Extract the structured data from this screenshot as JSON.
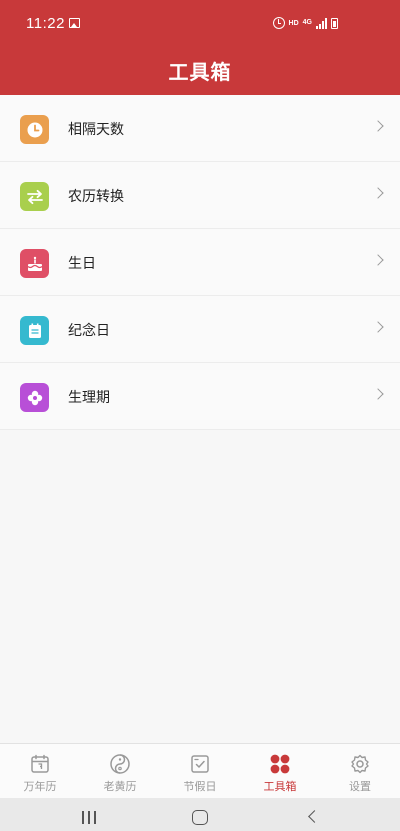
{
  "status": {
    "time": "11:22",
    "hd": "HD",
    "network": "4G"
  },
  "header": {
    "title": "工具箱"
  },
  "tools": [
    {
      "label": "相隔天数",
      "icon": "clock-icon",
      "color": "#ea9f4e"
    },
    {
      "label": "农历转换",
      "icon": "swap-arrows-icon",
      "color": "#a9cf4d"
    },
    {
      "label": "生日",
      "icon": "birthday-cake-icon",
      "color": "#df4f66"
    },
    {
      "label": "纪念日",
      "icon": "calendar-note-icon",
      "color": "#35b9cf"
    },
    {
      "label": "生理期",
      "icon": "flower-icon",
      "color": "#b84fd7"
    }
  ],
  "tabs": [
    {
      "label": "万年历",
      "icon": "calendar-icon",
      "active": false
    },
    {
      "label": "老黄历",
      "icon": "yin-yang-icon",
      "active": false
    },
    {
      "label": "节假日",
      "icon": "checklist-icon",
      "active": false
    },
    {
      "label": "工具箱",
      "icon": "toolbox-grid-icon",
      "active": true
    },
    {
      "label": "设置",
      "icon": "gear-icon",
      "active": false
    }
  ],
  "colors": {
    "primary": "#c8393a",
    "inactive": "#999999",
    "background": "#f7f7f7"
  }
}
